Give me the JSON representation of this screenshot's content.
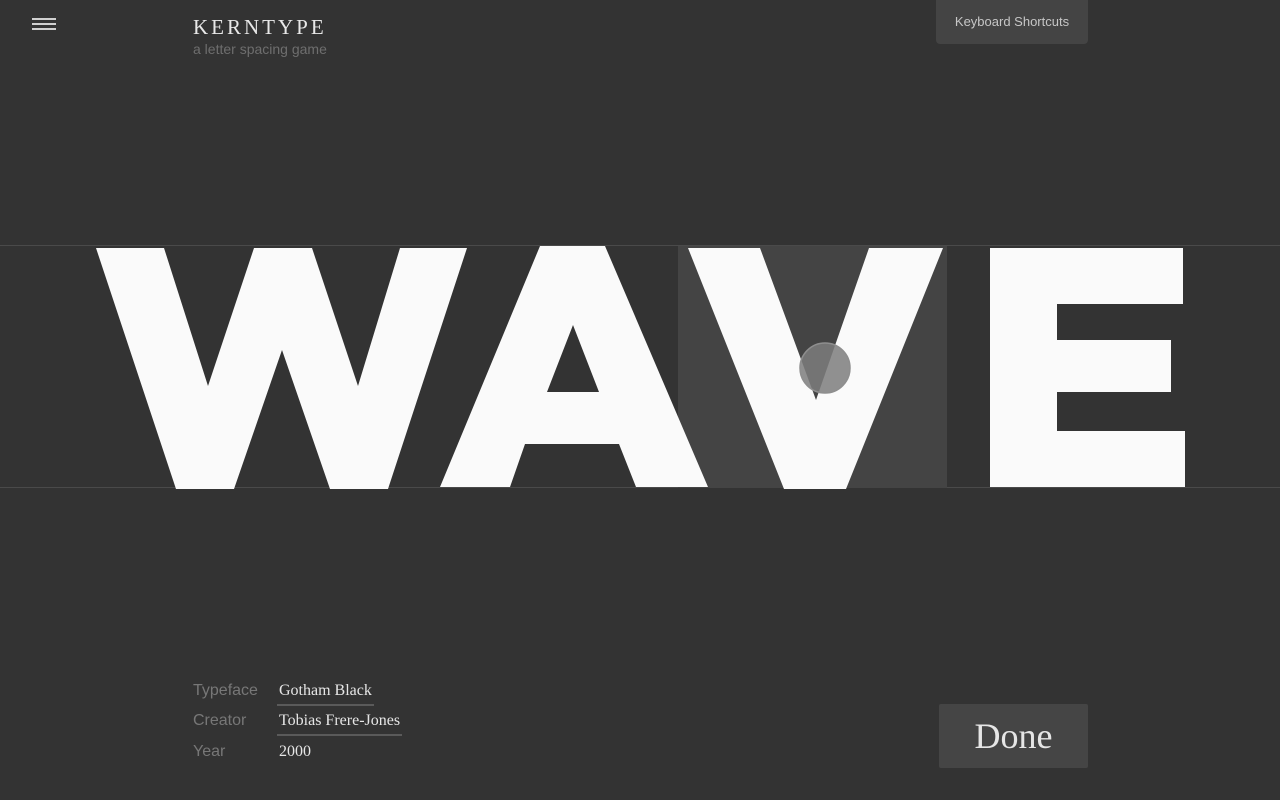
{
  "header": {
    "logo": "KERNTYPE",
    "tagline": "a letter spacing game",
    "keyboard_shortcuts_label": "Keyboard Shortcuts",
    "menu_icon": "hamburger-menu-icon"
  },
  "puzzle": {
    "word": "WAVE",
    "letters": [
      "W",
      "A",
      "V",
      "E"
    ],
    "selected_letter": "V",
    "colors": {
      "background": "#333333",
      "letter": "#fafafa",
      "selection": "#444444",
      "guide_line": "#4a4a4a"
    }
  },
  "info": {
    "typeface_label": "Typeface",
    "typeface_value": "Gotham Black",
    "creator_label": "Creator",
    "creator_value": "Tobias Frere-Jones",
    "year_label": "Year",
    "year_value": "2000"
  },
  "done_label": "Done"
}
